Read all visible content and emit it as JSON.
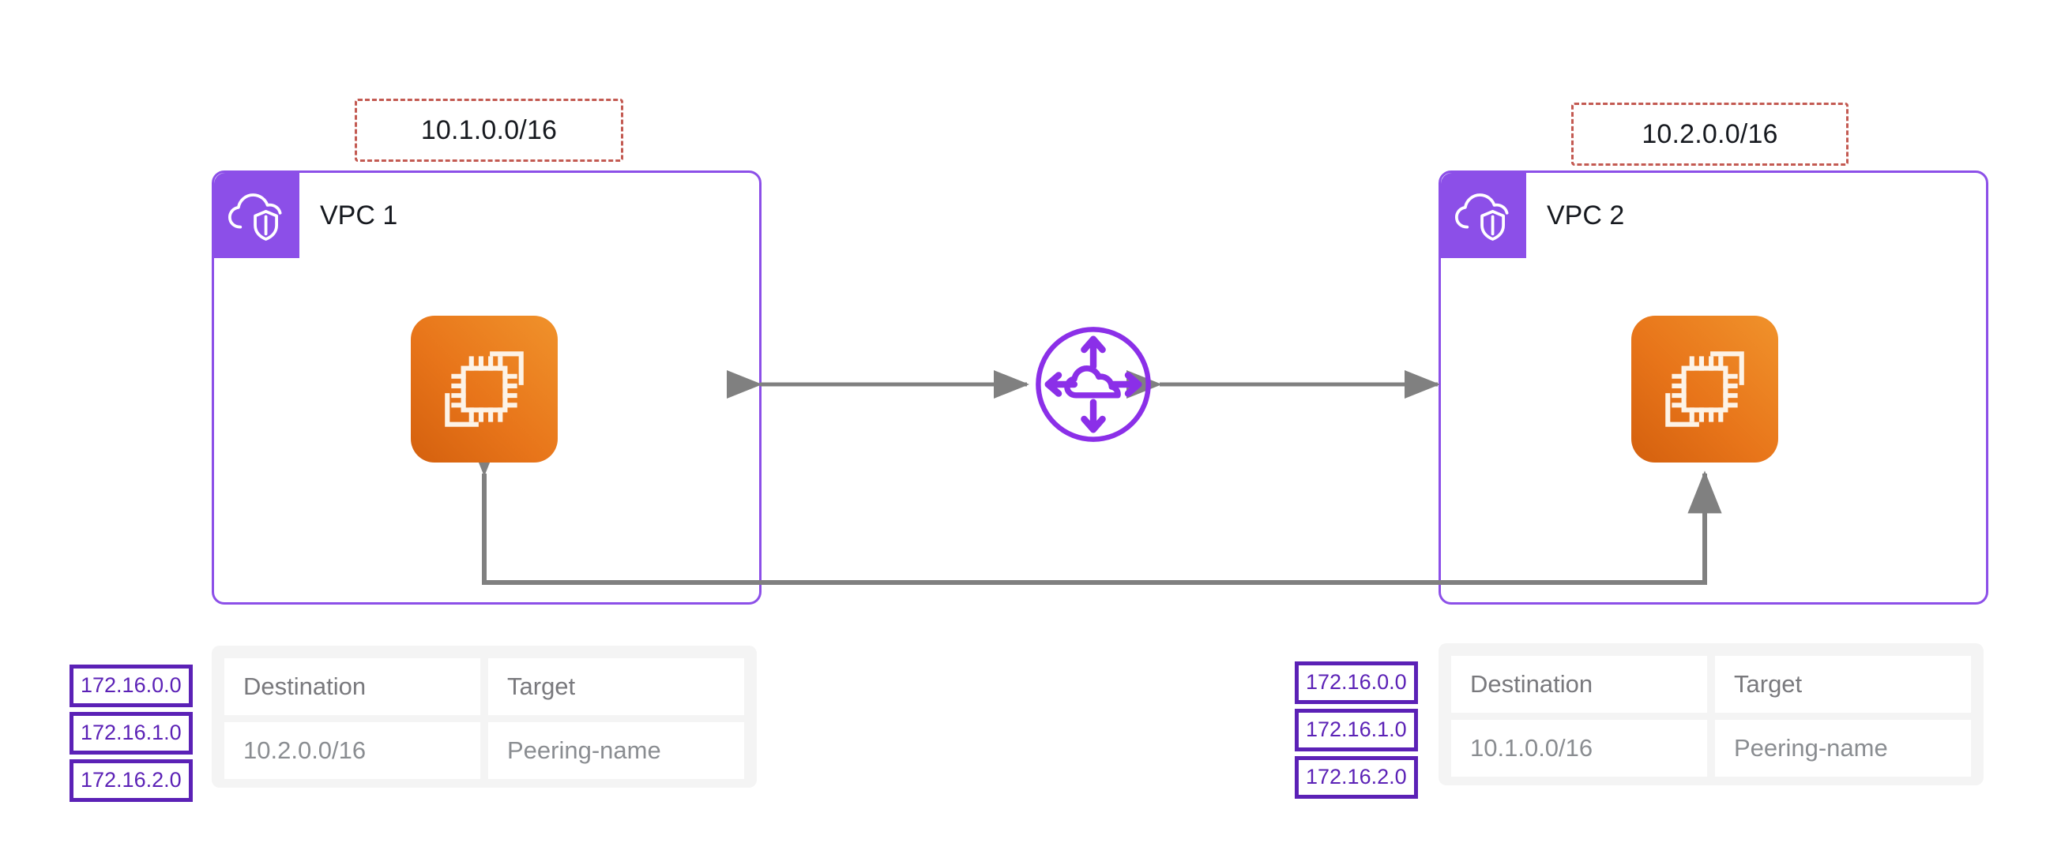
{
  "diagram": {
    "title": "AWS VPC Peering Diagram",
    "background_color": "#ffffff",
    "colors": {
      "vpc_border": "#8C4FE8",
      "vpc_badge": "#8C4FE8",
      "cidr_border": "#C35A52",
      "ec2_gradient_from": "#D4600E",
      "ec2_gradient_to": "#F0922B",
      "connector": "#808080",
      "subnet_border": "#5B21B6",
      "subnet_text": "#5B21B6",
      "table_bg": "#f4f4f4",
      "table_cell_bg": "#ffffff",
      "table_text": "#8a8d91"
    }
  },
  "left": {
    "cidr_label": "10.1.0.0/16",
    "vpc_name": "VPC 1",
    "vpc_icon": "vpc-cloud-shield-icon",
    "compute_icon": "ec2-instances-icon",
    "subnets": [
      "172.16.0.0",
      "172.16.1.0",
      "172.16.2.0"
    ],
    "route_table": {
      "headers": [
        "Destination",
        "Target"
      ],
      "rows": [
        [
          "10.2.0.0/16",
          "Peering-name"
        ]
      ]
    }
  },
  "right": {
    "cidr_label": "10.2.0.0/16",
    "vpc_name": "VPC 2",
    "vpc_icon": "vpc-cloud-shield-icon",
    "compute_icon": "ec2-instances-icon",
    "subnets": [
      "172.16.0.0",
      "172.16.1.0",
      "172.16.2.0"
    ],
    "route_table": {
      "headers": [
        "Destination",
        "Target"
      ],
      "rows": [
        [
          "10.1.0.0/16",
          "Peering-name"
        ]
      ]
    }
  },
  "peering": {
    "icon": "vpc-peering-connection-icon",
    "label": ""
  }
}
